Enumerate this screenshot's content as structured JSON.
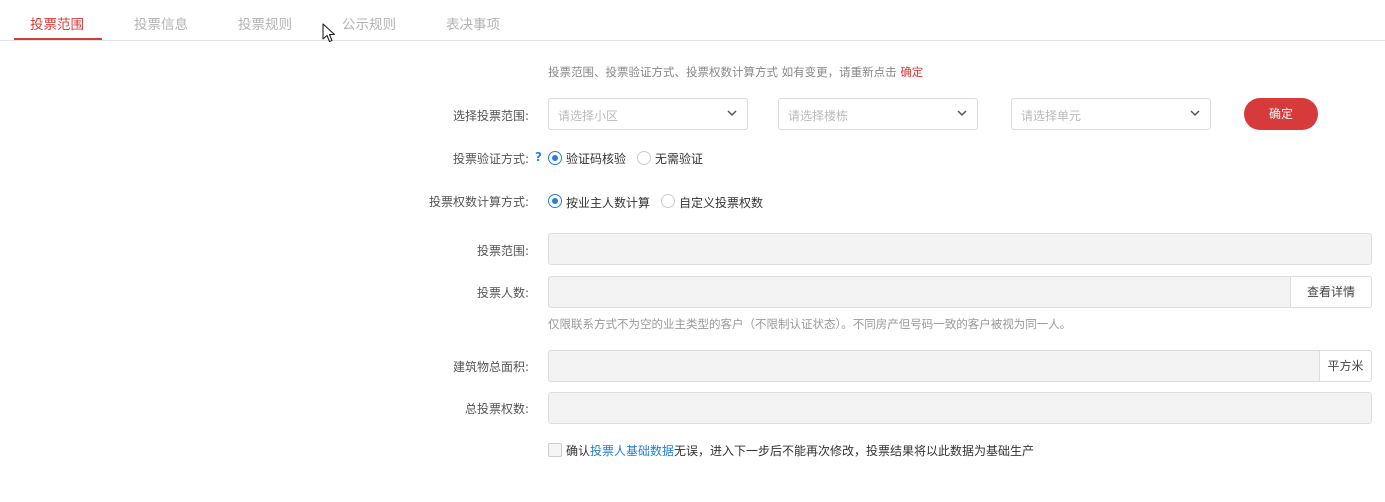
{
  "tabs": [
    {
      "label": "投票范围",
      "active": true
    },
    {
      "label": "投票信息",
      "active": false
    },
    {
      "label": "投票规则",
      "active": false
    },
    {
      "label": "公示规则",
      "active": false
    },
    {
      "label": "表决事项",
      "active": false
    }
  ],
  "hint": {
    "prefix": "投票范围、投票验证方式、投票权数计算方式 如有变更，请重新点击 ",
    "highlight": "确定"
  },
  "scope_select": {
    "label": "选择投票范围:",
    "community_placeholder": "请选择小区",
    "building_placeholder": "请选择楼栋",
    "unit_placeholder": "请选择单元",
    "confirm_label": "确定"
  },
  "verify": {
    "label": "投票验证方式:",
    "help": "?",
    "options": [
      {
        "label": "验证码核验",
        "checked": true
      },
      {
        "label": "无需验证",
        "checked": false
      }
    ]
  },
  "weight": {
    "label": "投票权数计算方式:",
    "options": [
      {
        "label": "按业主人数计算",
        "checked": true
      },
      {
        "label": "自定义投票权数",
        "checked": false
      }
    ]
  },
  "fields": {
    "scope_label": "投票范围:",
    "count_label": "投票人数:",
    "count_detail": "查看详情",
    "count_note": "仅限联系方式不为空的业主类型的客户（不限制认证状态）。不同房产但号码一致的客户被视为同一人。",
    "area_label": "建筑物总面积:",
    "area_unit": "平方米",
    "total_label": "总投票权数:"
  },
  "confirm": {
    "prefix": "确认",
    "link": "投票人基础数据",
    "suffix": "无误，进入下一步后不能再次修改，投票结果将以此数据为基础生产",
    "checked": false
  },
  "colors": {
    "accent": "#d63a3a",
    "link": "#1e7fd8",
    "radio": "#2b7cd3"
  }
}
